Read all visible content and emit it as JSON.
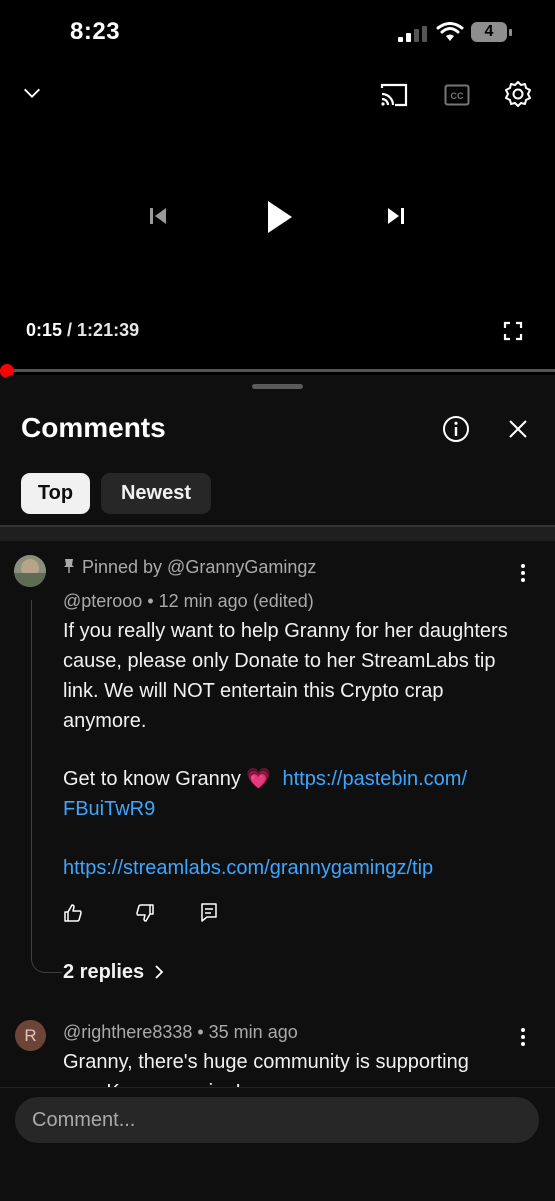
{
  "status_bar": {
    "time": "8:23",
    "battery_level": "4"
  },
  "player": {
    "current_time": "0:15",
    "separator": " / ",
    "duration": "1:21:39",
    "progress_fraction": 0.003,
    "accent_color": "#ff0000"
  },
  "comments_panel": {
    "title": "Comments",
    "chips": [
      {
        "label": "Top",
        "selected": true
      },
      {
        "label": "Newest",
        "selected": false
      }
    ],
    "comments": [
      {
        "pinned_label": "Pinned by @GrannyGamingz",
        "author": "@pterooo",
        "meta": " • 12 min ago (edited)",
        "paragraph1": "If you really want to help Granny for her daughters cause, please only Donate to her StreamLabs tip link. We will NOT entertain this Crypto crap anymore.",
        "line2_prefix": "Get to know Granny ",
        "emoji": "💗",
        "link1_part1": "https://pastebin.com/",
        "link1_part2": "FBuiTwR9",
        "link2": "https://streamlabs.com/grannygamingz/tip",
        "replies_label": "2 replies"
      },
      {
        "avatar_letter": "R",
        "author": "@righthere8338",
        "meta": " • 35 min ago",
        "text_line1": "Granny, there's huge community is supporting",
        "text_line2": "you. Keep on going!"
      }
    ]
  },
  "comment_input": {
    "placeholder": "Comment..."
  },
  "icons": [
    "chevron-down-icon",
    "cast-icon",
    "captions-icon",
    "settings-gear-icon",
    "previous-icon",
    "play-icon",
    "next-icon",
    "fullscreen-icon",
    "info-icon",
    "close-icon",
    "pin-icon",
    "more-vert-icon",
    "like-icon",
    "dislike-icon",
    "reply-icon",
    "chevron-right-icon"
  ]
}
